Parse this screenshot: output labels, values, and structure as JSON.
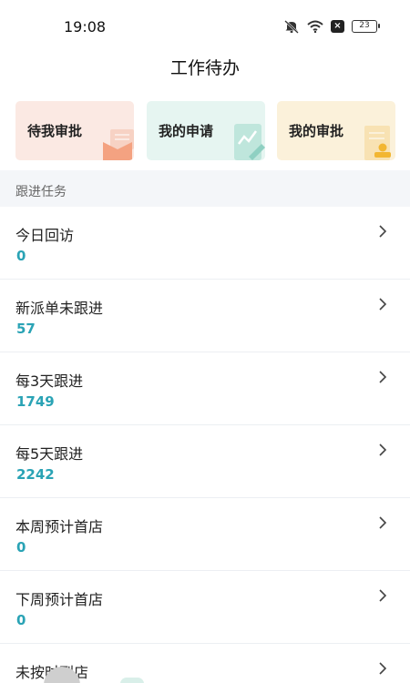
{
  "status_bar": {
    "time": "19:08",
    "battery": "23"
  },
  "header": {
    "title": "工作待办"
  },
  "cards": [
    {
      "label": "待我审批",
      "color": "#fbe9e3"
    },
    {
      "label": "我的申请",
      "color": "#e6f5f1"
    },
    {
      "label": "我的审批",
      "color": "#fbf1da"
    }
  ],
  "section": {
    "title": "跟进任务"
  },
  "tasks": [
    {
      "label": "今日回访",
      "value": "0"
    },
    {
      "label": "新派单未跟进",
      "value": "57"
    },
    {
      "label": "每3天跟进",
      "value": "1749"
    },
    {
      "label": "每5天跟进",
      "value": "2242"
    },
    {
      "label": "本周预计首店",
      "value": "0"
    },
    {
      "label": "下周预计首店",
      "value": "0"
    },
    {
      "label": "未按时到店",
      "value": ""
    }
  ],
  "colors": {
    "accent": "#2aa3b5",
    "section_bg": "#f4f6f9"
  }
}
